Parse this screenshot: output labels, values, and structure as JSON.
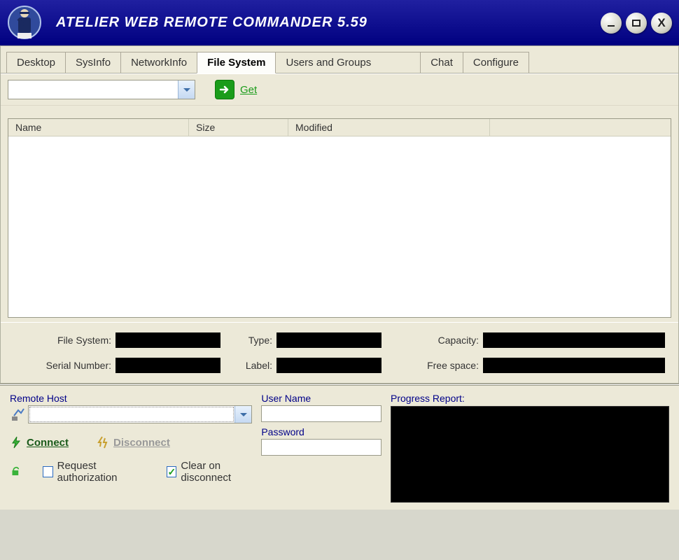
{
  "title": "ATELIER WEB REMOTE COMMANDER 5.59",
  "tabs": [
    "Desktop",
    "SysInfo",
    "NetworkInfo",
    "File System",
    "Users and Groups",
    "Chat",
    "Configure"
  ],
  "activeTabIndex": 3,
  "get_label": "Get",
  "path_value": "",
  "columns": {
    "name": "Name",
    "size": "Size",
    "modified": "Modified"
  },
  "info": {
    "file_system_label": "File System:",
    "serial_label": "Serial Number:",
    "type_label": "Type:",
    "label_label": "Label:",
    "capacity_label": "Capacity:",
    "free_label": "Free space:",
    "file_system": "",
    "serial": "",
    "type": "",
    "label": "",
    "capacity": "",
    "free": ""
  },
  "conn": {
    "remote_host_label": "Remote Host",
    "user_name_label": "User Name",
    "password_label": "Password",
    "progress_label": "Progress Report:",
    "connect_label": "Connect",
    "disconnect_label": "Disconnect",
    "request_auth_label": "Request authorization",
    "clear_label": "Clear on disconnect",
    "host_value": "",
    "user_value": "",
    "password_value": "",
    "request_auth_checked": false,
    "clear_checked": true
  }
}
